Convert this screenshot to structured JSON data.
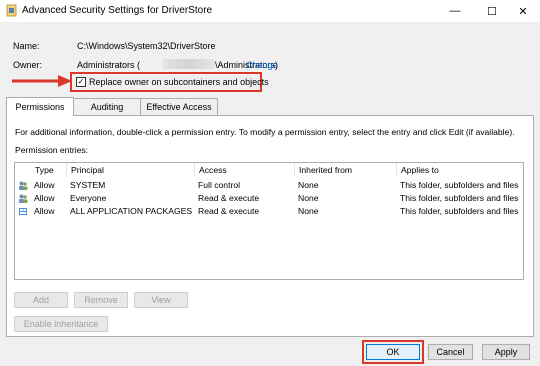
{
  "window": {
    "title": "Advanced Security Settings for DriverStore",
    "minimize": "—",
    "maximize": "☐",
    "close": "✕"
  },
  "name_label": "Name:",
  "name_value": "C:\\Windows\\System32\\DriverStore",
  "owner_label": "Owner:",
  "owner_value_prefix": "Administrators (",
  "owner_value_suffix": "\\Administrators)",
  "owner_change_link": "Change",
  "replace_owner_checkbox": {
    "label": "Replace owner on subcontainers and objects",
    "checked": true
  },
  "tabs": [
    {
      "label": "Permissions",
      "active": true
    },
    {
      "label": "Auditing",
      "active": false
    },
    {
      "label": "Effective Access",
      "active": false
    }
  ],
  "info_text": "For additional information, double-click a permission entry. To modify a permission entry, select the entry and click Edit (if available).",
  "permission_entries_label": "Permission entries:",
  "table": {
    "columns": [
      "Type",
      "Principal",
      "Access",
      "Inherited from",
      "Applies to"
    ],
    "rows": [
      {
        "type": "Allow",
        "principal": "SYSTEM",
        "access": "Full control",
        "inherited": "None",
        "applies": "This folder, subfolders and files"
      },
      {
        "type": "Allow",
        "principal": "Everyone",
        "access": "Read & execute",
        "inherited": "None",
        "applies": "This folder, subfolders and files"
      },
      {
        "type": "Allow",
        "principal": "ALL APPLICATION PACKAGES",
        "access": "Read & execute",
        "inherited": "None",
        "applies": "This folder, subfolders and files"
      }
    ]
  },
  "buttons": {
    "add": "Add",
    "remove": "Remove",
    "view": "View",
    "enable_inheritance": "Enable inheritance",
    "ok": "OK",
    "cancel": "Cancel",
    "apply": "Apply"
  },
  "colors": {
    "highlight_red": "#d9382a",
    "link_blue": "#0066cc",
    "dialog_bg": "#f0f0f0"
  }
}
